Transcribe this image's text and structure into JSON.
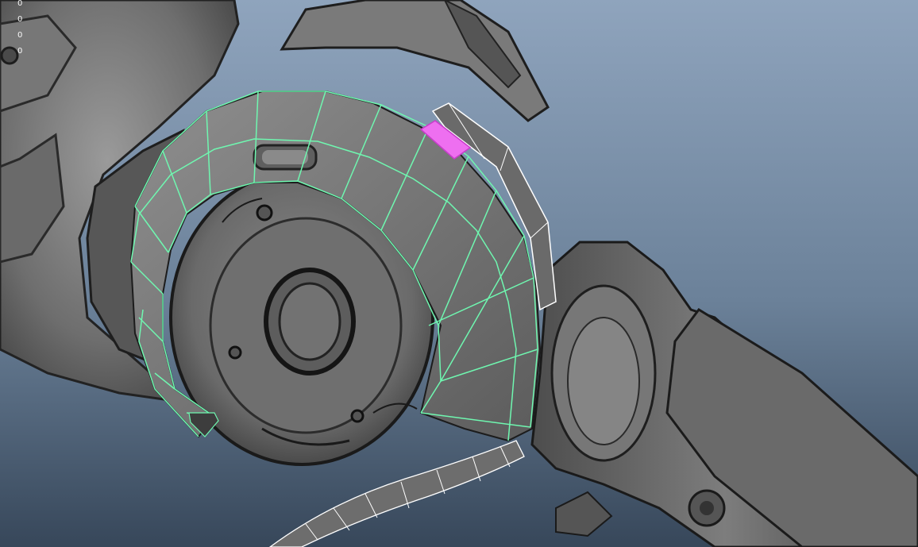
{
  "viewport": {
    "background_top": "#8da2bb",
    "background_mid": "#6f869f",
    "background_bottom": "#3a4a5b",
    "selection_wire_color": "#6ff7b0",
    "wire_color": "#ffffff",
    "selected_face_color": "#ee6ff0"
  },
  "hud": {
    "counters": [
      "0",
      "0",
      "0",
      "0"
    ]
  }
}
